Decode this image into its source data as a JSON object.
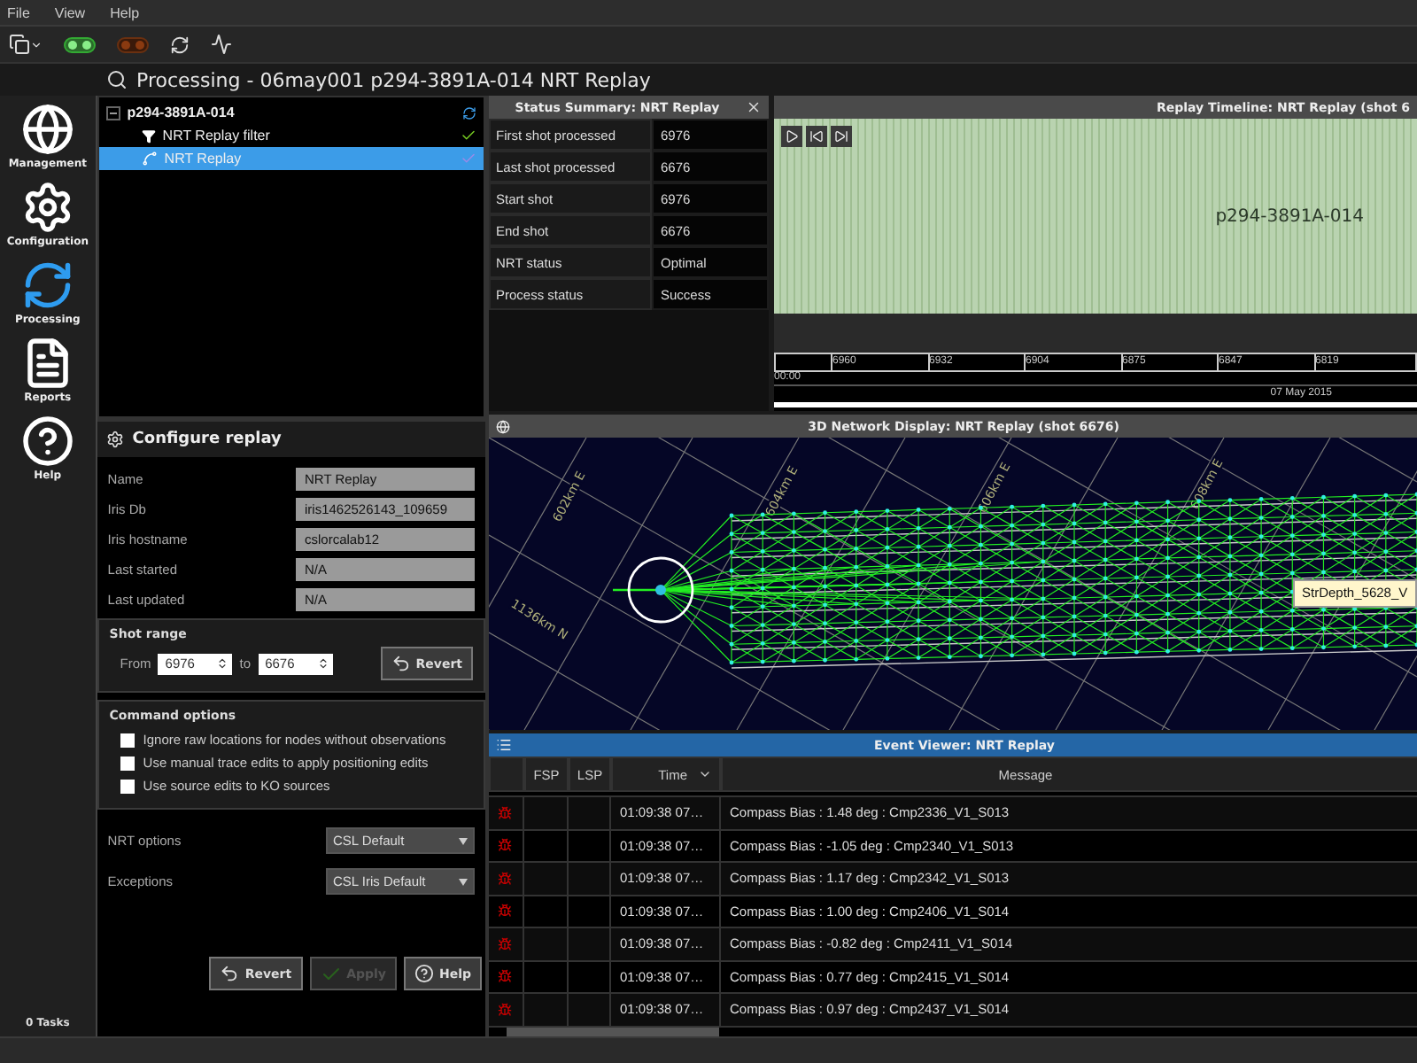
{
  "menu": [
    "File",
    "View",
    "Help"
  ],
  "title": "Processing - 06may001 p294-3891A-014 NRT Replay",
  "nav": {
    "items": [
      {
        "label": "Management",
        "kind": "management",
        "selected": false
      },
      {
        "label": "Configuration",
        "kind": "configuration",
        "selected": false
      },
      {
        "label": "Processing",
        "kind": "processing",
        "selected": true
      },
      {
        "label": "Reports",
        "kind": "reports",
        "selected": false
      },
      {
        "label": "Help",
        "kind": "help",
        "selected": false
      }
    ],
    "tasks": "0 Tasks"
  },
  "tree": {
    "label": "p294-3891A-014",
    "expanded": true,
    "children": [
      {
        "label": "NRT Replay filter",
        "kind": "filter",
        "selected": false
      },
      {
        "label": "NRT Replay",
        "kind": "replay",
        "selected": true
      }
    ]
  },
  "configure": {
    "title": "Configure replay",
    "fields": [
      {
        "label": "Name",
        "value": "NRT Replay"
      },
      {
        "label": "Iris Db",
        "value": "iris1462526143_109659"
      },
      {
        "label": "Iris hostname",
        "value": "cslorcalab12"
      },
      {
        "label": "Last started",
        "value": "N/A"
      },
      {
        "label": "Last updated",
        "value": "N/A"
      }
    ],
    "shot_range": {
      "title": "Shot range",
      "from_label": "From",
      "from": "6976",
      "to_label": "to",
      "to": "6676",
      "revert": "Revert"
    },
    "command_options": {
      "title": "Command options",
      "options": [
        {
          "label": "Ignore raw locations for nodes without observations",
          "checked": false
        },
        {
          "label": "Use manual trace edits to apply positioning edits",
          "checked": false
        },
        {
          "label": "Use source edits to KO sources",
          "checked": false
        }
      ]
    },
    "selects": [
      {
        "label": "NRT options",
        "value": "CSL Default"
      },
      {
        "label": "Exceptions",
        "value": "CSL Iris Default"
      }
    ],
    "buttons": [
      {
        "label": "Revert",
        "kind": "revert",
        "disabled": false
      },
      {
        "label": "Apply",
        "kind": "apply",
        "disabled": true
      },
      {
        "label": "Help",
        "kind": "help",
        "disabled": false
      }
    ]
  },
  "status_summary": {
    "title": "Status Summary: NRT Replay",
    "rows": [
      {
        "label": "First shot processed",
        "value": "6976"
      },
      {
        "label": "Last shot processed",
        "value": "6676"
      },
      {
        "label": "Start shot",
        "value": "6976"
      },
      {
        "label": "End shot",
        "value": "6676"
      },
      {
        "label": "NRT status",
        "value": "Optimal"
      },
      {
        "label": "Process status",
        "value": "Success"
      }
    ]
  },
  "timeline": {
    "title": "Replay Timeline: NRT Replay (shot 6",
    "track_label": "p294-3891A-014",
    "ticks": [
      "6960",
      "6932",
      "6904",
      "6875",
      "6847",
      "6819"
    ],
    "start_time": "00:00",
    "date": "07 May 2015"
  },
  "network": {
    "title": "3D Network Display: NRT Replay (shot 6676)",
    "grid_labels": [
      "602km E",
      "604km E",
      "606km E",
      "608km E",
      "1136km N"
    ],
    "tooltip": "StrDepth_5628_V"
  },
  "events": {
    "title": "Event Viewer: NRT Replay",
    "columns": [
      {
        "label": "FSP",
        "kind": "text"
      },
      {
        "label": "LSP",
        "kind": "text"
      },
      {
        "label": "Time",
        "kind": "sorted"
      },
      {
        "label": "Message",
        "kind": "text"
      }
    ],
    "rows": [
      {
        "time": "01:09:38 07…",
        "message": "Compass Bias : 1.48 deg : Cmp2336_V1_S013"
      },
      {
        "time": "01:09:38 07…",
        "message": "Compass Bias : -1.05 deg : Cmp2340_V1_S013"
      },
      {
        "time": "01:09:38 07…",
        "message": "Compass Bias : 1.17 deg : Cmp2342_V1_S013"
      },
      {
        "time": "01:09:38 07…",
        "message": "Compass Bias : 1.00 deg : Cmp2406_V1_S014"
      },
      {
        "time": "01:09:38 07…",
        "message": "Compass Bias : -0.82 deg : Cmp2411_V1_S014"
      },
      {
        "time": "01:09:38 07…",
        "message": "Compass Bias : 0.77 deg : Cmp2415_V1_S014"
      },
      {
        "time": "01:09:38 07…",
        "message": "Compass Bias : 0.97 deg : Cmp2437_V1_S014"
      }
    ]
  }
}
